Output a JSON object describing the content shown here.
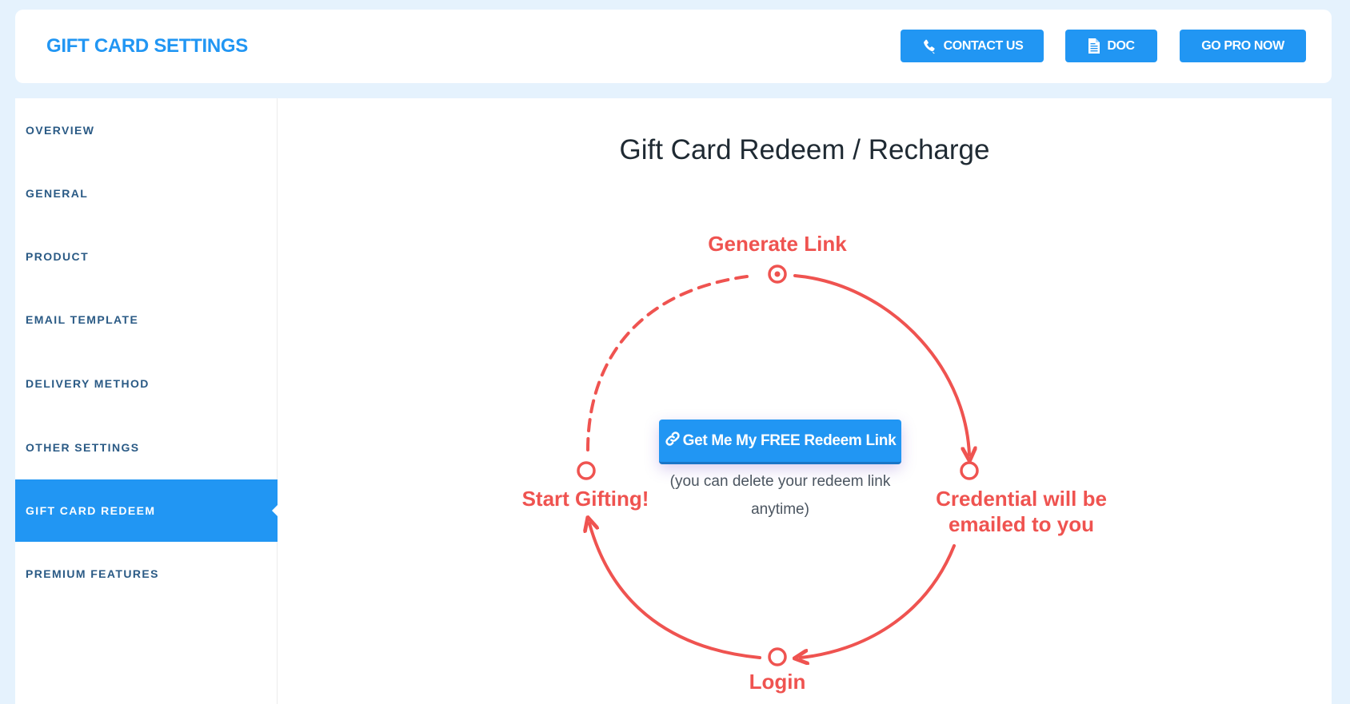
{
  "header": {
    "title": "GIFT CARD SETTINGS",
    "buttons": {
      "contact": {
        "label": "CONTACT US",
        "icon": "phone-icon"
      },
      "doc": {
        "label": "DOC",
        "icon": "document-icon"
      },
      "pro": {
        "label": "GO PRO NOW"
      }
    }
  },
  "sidebar": {
    "active": "GIFT CARD REDEEM",
    "items": [
      {
        "label": "OVERVIEW"
      },
      {
        "label": "GENERAL"
      },
      {
        "label": "PRODUCT"
      },
      {
        "label": "EMAIL TEMPLATE"
      },
      {
        "label": "DELIVERY METHOD"
      },
      {
        "label": "OTHER SETTINGS"
      },
      {
        "label": "GIFT CARD REDEEM"
      },
      {
        "label": "PREMIUM FEATURES"
      }
    ]
  },
  "main": {
    "title": "Gift Card Redeem / Recharge",
    "diagram": {
      "steps": {
        "generate": "Generate Link",
        "credential": "Credential will be emailed to you",
        "login": "Login",
        "gifting": "Start Gifting!"
      },
      "credential_line1": "Credential will be",
      "credential_line2": "emailed to you"
    },
    "cta": {
      "label": "Get Me My FREE Redeem Link",
      "icon": "link-icon"
    },
    "cta_note": "(you can delete your redeem link anytime)"
  },
  "colors": {
    "accent": "#2196f3",
    "diagram": "#ef5350",
    "background": "#e5f2fd",
    "sidebar_text": "#2a5a85"
  }
}
